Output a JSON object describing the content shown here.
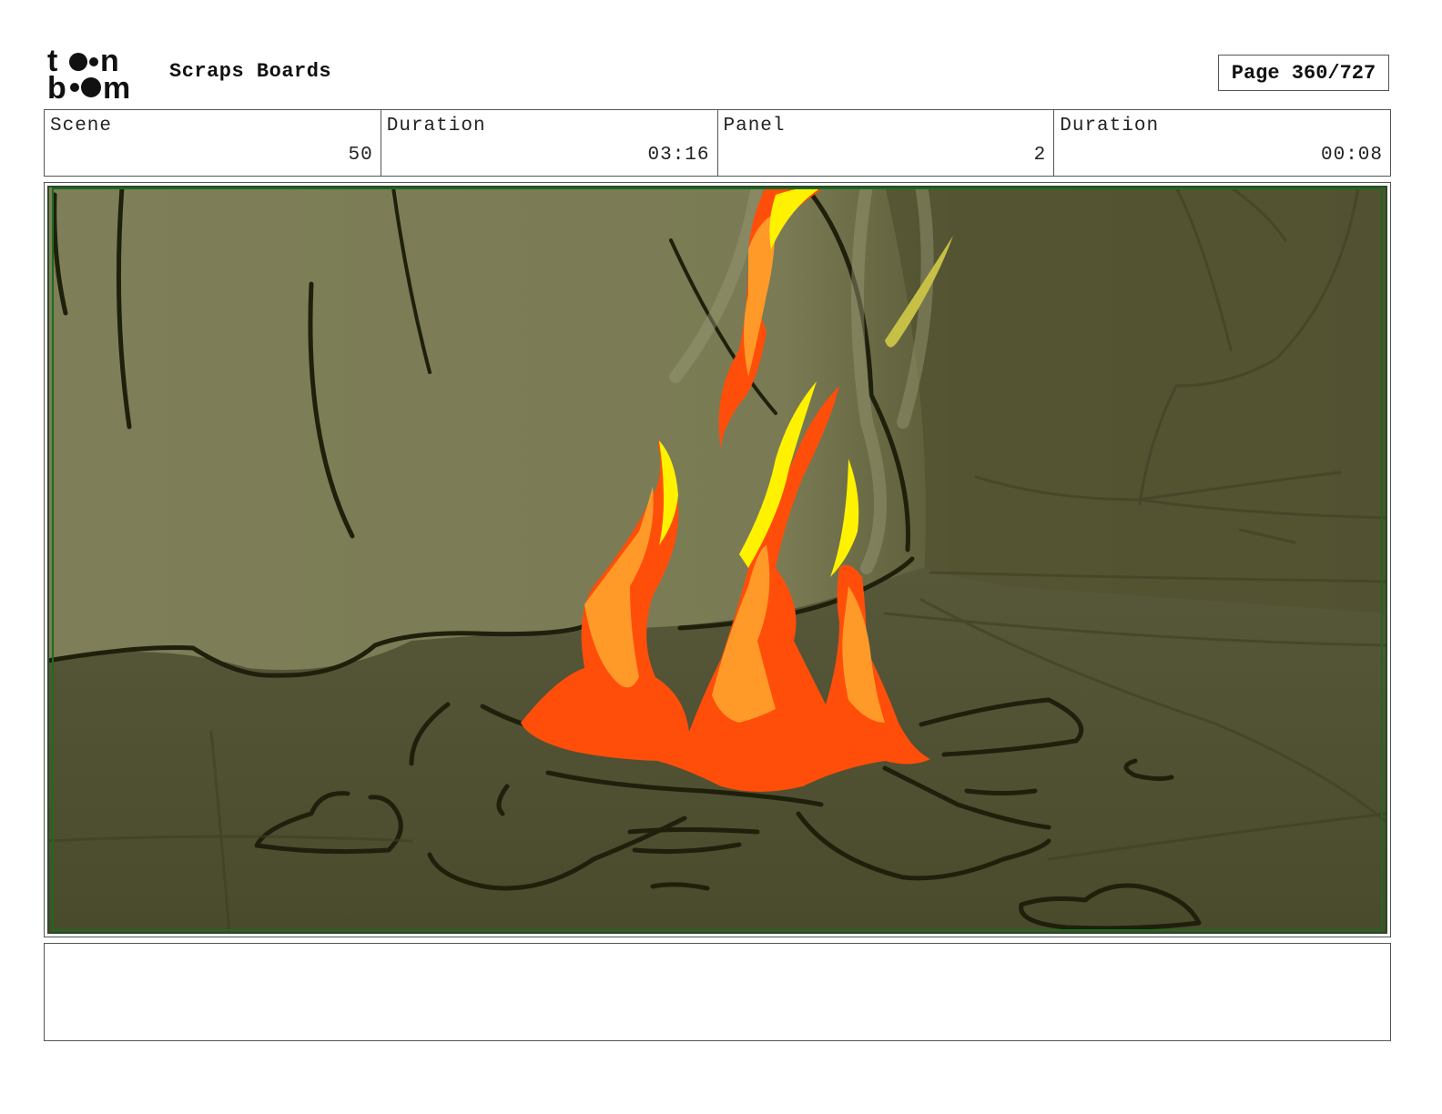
{
  "header": {
    "logo_alt": "toonboom",
    "app_title": "Scraps Boards",
    "page_indicator": "Page 360/727"
  },
  "info": {
    "scene_label": "Scene",
    "scene_value": "50",
    "scene_duration_label": "Duration",
    "scene_duration_value": "03:16",
    "panel_label": "Panel",
    "panel_value": "2",
    "panel_duration_label": "Duration",
    "panel_duration_value": "00:08"
  },
  "artwork": {
    "description_icon": "campfire-scene",
    "colors": {
      "background_light": "#7e7f58",
      "background_dark": "#545433",
      "floor": "#4f5032",
      "line": "#1f200c",
      "flame_red": "#ff4e0a",
      "flame_orange": "#ff9a28",
      "flame_yellow": "#fff200",
      "safe_frame": "#1d6b1d"
    }
  },
  "notes": {
    "text": ""
  }
}
